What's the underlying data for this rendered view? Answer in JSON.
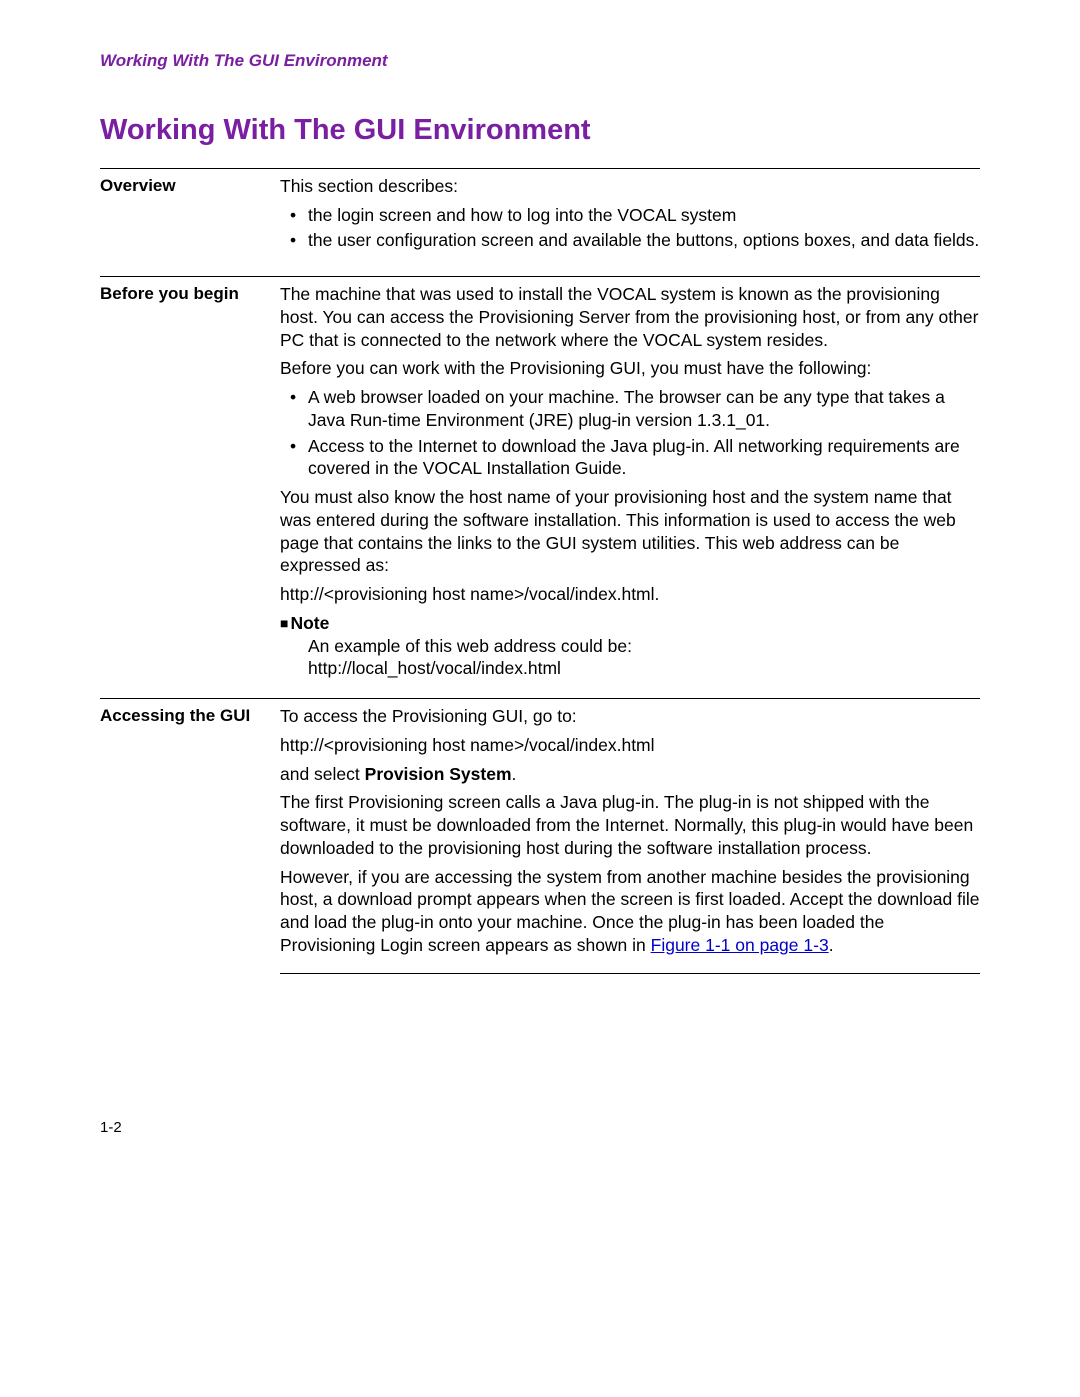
{
  "runningHeader": "Working With The GUI Environment",
  "pageTitle": "Working With The GUI Environment",
  "sections": {
    "overview": {
      "label": "Overview",
      "intro": "This section describes:",
      "bullets": [
        "the login screen and how to log into the VOCAL system",
        "the user configuration screen and available the buttons, options boxes, and data fields."
      ]
    },
    "before": {
      "label": "Before you begin",
      "p1": "The machine that was used to install the VOCAL system is known as the provisioning host. You can access the Provisioning Server from the provisioning host, or from any other PC that is connected to the network where the VOCAL system resides.",
      "p2": "Before you can work with the Provisioning GUI, you must have the following:",
      "bullets": [
        "A web browser loaded on your machine. The browser can be any type that takes a Java Run-time Environment (JRE) plug-in version 1.3.1_01.",
        "Access to the Internet to download the Java plug-in. All networking requirements are covered in the VOCAL Installation Guide."
      ],
      "p3": "You must also know the host name of your provisioning host and the system name that was entered during the software installation. This information is used to access the web page that contains the links to the GUI system utilities. This web address can be expressed as:",
      "p4": "http://<provisioning host name>/vocal/index.html.",
      "noteLabel": "Note",
      "noteLine1": "An example of this web address could be:",
      "noteLine2": "http://local_host/vocal/index.html"
    },
    "accessing": {
      "label": "Accessing the GUI",
      "p1": "To access the Provisioning GUI, go to:",
      "p2": "http://<provisioning host name>/vocal/index.html",
      "p3a": "and select ",
      "p3b": "Provision System",
      "p3c": ".",
      "p4": "The first Provisioning screen calls a Java plug-in. The plug-in is not shipped with the software, it must be downloaded from the Internet. Normally, this plug-in would have been downloaded to the provisioning host during the software installation process.",
      "p5a": "However, if you are accessing the system from another machine besides the provisioning host, a download prompt appears when the screen is first loaded. Accept the download file and load the plug-in onto your machine. Once the plug-in has been loaded the Provisioning Login screen appears as shown in ",
      "p5link": "Figure 1-1 on page 1-3",
      "p5b": "."
    }
  },
  "pageNumber": "1-2"
}
